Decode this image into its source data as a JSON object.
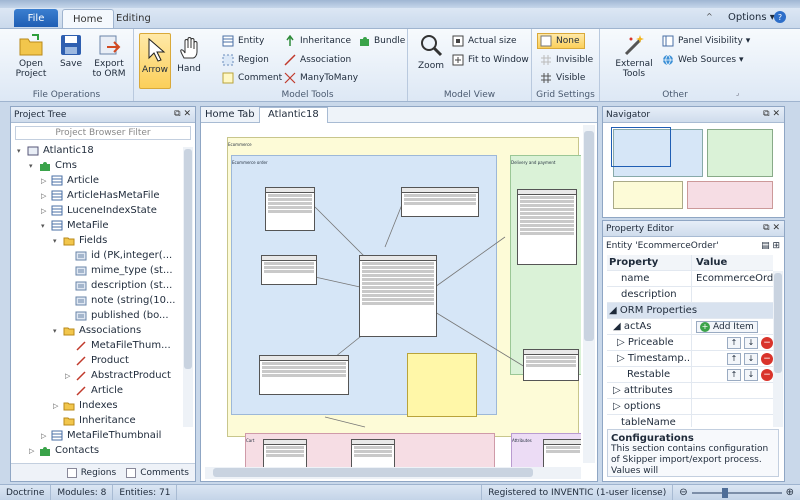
{
  "ribbon_tabs": {
    "file": "File",
    "home": "Home",
    "editing": "Editing"
  },
  "options": "Options",
  "ribbon": {
    "file_ops": {
      "label": "File Operations",
      "open": "Open Project",
      "save": "Save",
      "export": "Export to ORM"
    },
    "arrow": "Arrow",
    "hand": "Hand",
    "model_tools": {
      "label": "Model Tools",
      "entity": "Entity",
      "region": "Region",
      "comment": "Comment",
      "inheritance": "Inheritance",
      "association": "Association",
      "many_to_many": "ManyToMany",
      "bundle": "Bundle"
    },
    "model_view": {
      "label": "Model View",
      "zoom": "Zoom",
      "actual_size": "Actual size",
      "fit": "Fit to Window"
    },
    "grid": {
      "label": "Grid Settings",
      "none": "None",
      "invisible": "Invisible",
      "visible": "Visible"
    },
    "other": {
      "label": "Other",
      "external_tools": "External Tools",
      "panel_visibility": "Panel Visibility",
      "web_sources": "Web Sources"
    }
  },
  "project_tree": {
    "title": "Project Tree",
    "filter_placeholder": "Project Browser Filter",
    "items": [
      "Atlantic18",
      "Cms",
      "Article",
      "ArticleHasMetaFile",
      "LuceneIndexState",
      "MetaFile",
      "Fields",
      "id (PK,integer(...",
      "mime_type (st...",
      "description (st...",
      "note (string(10...",
      "published (bo...",
      "Associations",
      "MetaFileThum...",
      "Product",
      "AbstractProduct",
      "Article",
      "Indexes",
      "Inheritance",
      "MetaFileThumbnail",
      "Contacts"
    ],
    "regions": "Regions",
    "comments": "Comments"
  },
  "doc_tabs": {
    "home": "Home Tab",
    "atlantic": "Atlantic18"
  },
  "diagram": {
    "region_ecommerce": "Ecommerce",
    "region_order": "Ecommerce order",
    "region_delivery": "Delivery and payment",
    "region_cart": "Cart",
    "region_attributes": "Attributes",
    "entities": [
      "EcommerceOrderState",
      "EcommerceOrderStateChange",
      "EcommerceOrderShipItem",
      "EcommerceOrder",
      "EcommerceOrderItem",
      "Payment",
      "PaymentMethodPricing",
      "Cart",
      "Cart",
      "ProductAttributeValue"
    ]
  },
  "navigator": {
    "title": "Navigator"
  },
  "property_editor": {
    "title": "Property Editor",
    "entity": "Entity 'EcommerceOrder'",
    "col_property": "Property",
    "col_value": "Value",
    "rows": {
      "name": "name",
      "name_value": "EcommerceOrder",
      "description": "description",
      "orm_section": "ORM Properties",
      "act_as": "actAs",
      "add_item": "Add Item",
      "priceable": "Priceable",
      "timestampable": "Timestamp...",
      "restable": "Restable",
      "attributes": "attributes",
      "options": "options",
      "table_name": "tableName"
    },
    "help_title": "Configurations",
    "help_text": "This section contains configuration of Skipper import/export process. Values will"
  },
  "status": {
    "app": "Doctrine",
    "modules": "Modules: 8",
    "entities": "Entities: 71",
    "license": "Registered to INVENTIC (1-user license)"
  }
}
